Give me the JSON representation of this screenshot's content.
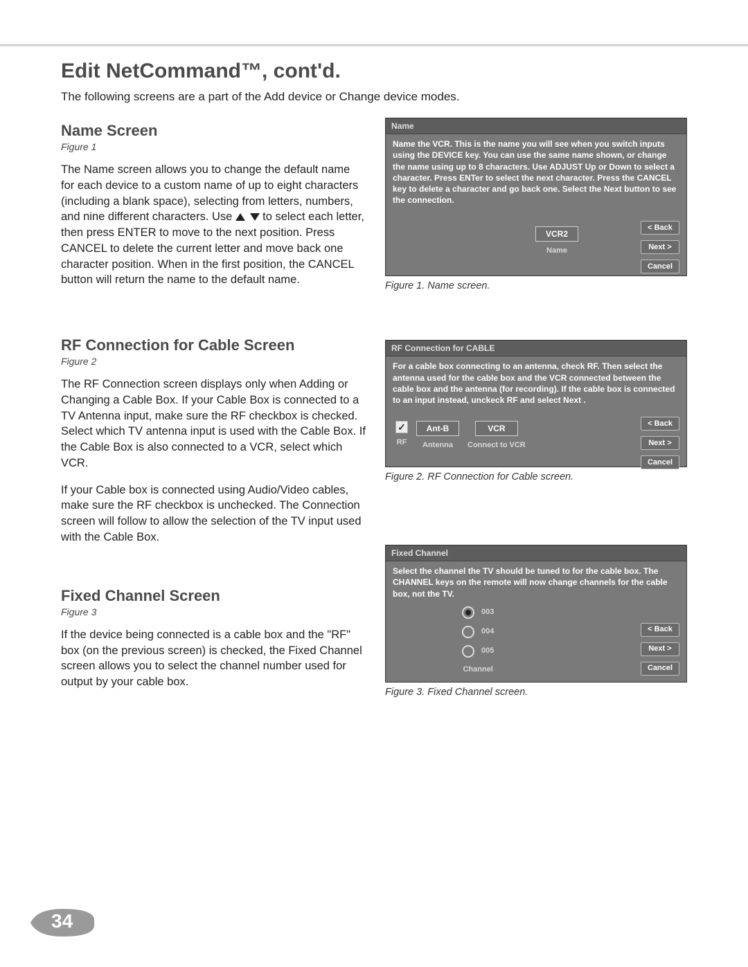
{
  "page": {
    "title": "Edit NetCommand™, cont'd.",
    "intro": "The following screens are a part of the Add device or Change device modes.",
    "number": "34"
  },
  "sections": {
    "name": {
      "heading": "Name Screen",
      "fig_ref": "Figure 1",
      "para1_a": "The Name screen allows you to change the default name for each device to a custom name of up to eight characters (including a blank space), selecting from letters, numbers, and nine different characters. Use ",
      "para1_b": " to select each letter, then press ENTER to move to the next position.  Press CANCEL to delete the current letter and move back one character position.  When in the first position, the CANCEL button will return the name to the default name."
    },
    "rf": {
      "heading": "RF Connection for Cable Screen",
      "fig_ref": "Figure 2",
      "para1": "The RF Connection screen displays only when Adding or Changing a Cable Box.  If your Cable Box is connected to a TV Antenna input, make sure the RF checkbox is checked.  Select which TV antenna input is used with the Cable Box.  If the Cable Box is also connected to a VCR, select which VCR.",
      "para2": "If your Cable box is connected using Audio/Video cables, make sure the RF checkbox is unchecked.  The Connection screen will follow to allow the selection of the TV input used with the Cable Box."
    },
    "fixed": {
      "heading": "Fixed Channel Screen",
      "fig_ref": "Figure 3",
      "para1": "If the device being connected is a cable box and the \"RF\" box (on the previous screen) is checked, the Fixed Channel screen allows you to select the channel number used for output by your cable box."
    }
  },
  "figures": {
    "f1": {
      "title": "Name",
      "instructions": "Name the VCR.  This is the name you will see when you switch inputs using the DEVICE key.  You can use the same name shown, or change the name using up to 8 characters. Use ADJUST Up or Down to select a character.  Press ENTer to select the next character.  Press the CANCEL key to delete a character and go back one.  Select the Next button to see the connection.",
      "value": "VCR2",
      "value_label": "Name",
      "buttons": {
        "back": "< Back",
        "next": "Next >",
        "cancel": "Cancel"
      },
      "caption": "Figure 1.  Name screen."
    },
    "f2": {
      "title": "RF Connection for CABLE",
      "instructions": "For a cable box connecting to an antenna, check RF.  Then select the antenna used for the cable box and the VCR connected between the cable box and the antenna (for recording).  If the cable box is connected to an input instead, unckeck RF and select Next .",
      "rf_label": "RF",
      "antenna_value": "Ant-B",
      "antenna_label": "Antenna",
      "vcr_value": "VCR",
      "vcr_label": "Connect to VCR",
      "buttons": {
        "back": "< Back",
        "next": "Next >",
        "cancel": "Cancel"
      },
      "caption": "Figure 2.  RF Connection for Cable screen."
    },
    "f3": {
      "title": "Fixed Channel",
      "instructions": "Select the channel the TV should be tuned to for the cable box.  The CHANNEL keys on the remote will now change channels for the cable box, not the TV.",
      "options": [
        "003",
        "004",
        "005"
      ],
      "selected_index": 0,
      "channel_label": "Channel",
      "buttons": {
        "back": "< Back",
        "next": "Next >",
        "cancel": "Cancel"
      },
      "caption": "Figure 3.  Fixed Channel screen."
    }
  }
}
